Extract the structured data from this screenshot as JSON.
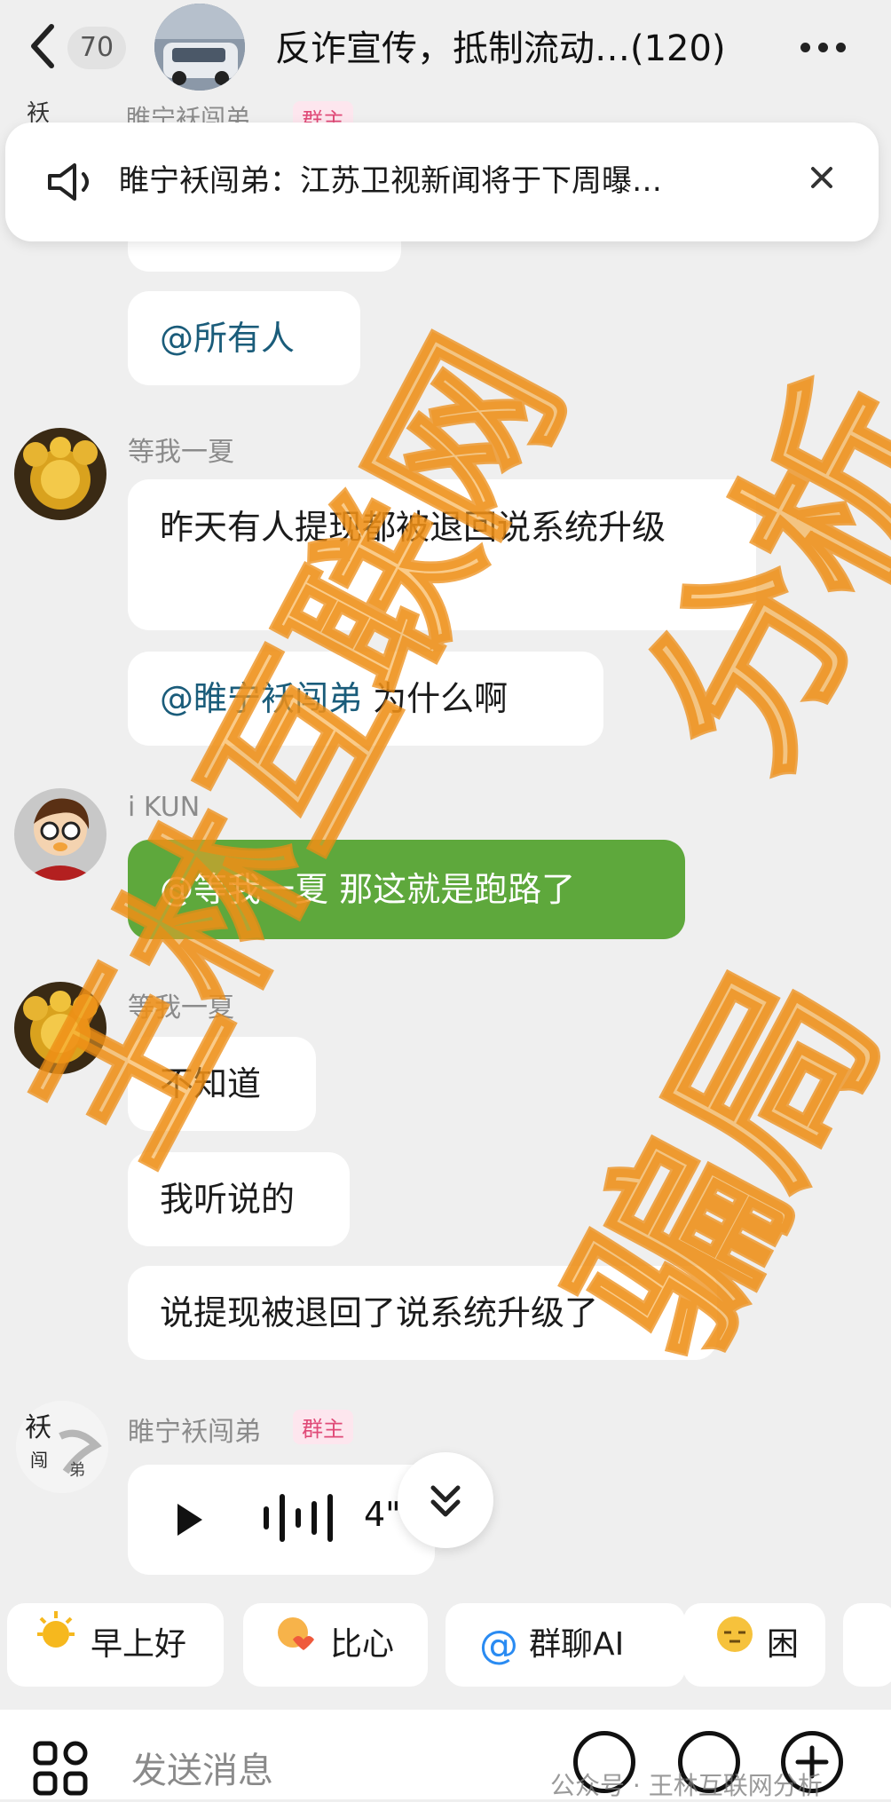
{
  "header": {
    "back_count": "70",
    "title": "反诈宣传，抵制流动…(120)"
  },
  "peek": {
    "sender": "睢宁袄闯弟",
    "role_tag": "群主"
  },
  "announcement": {
    "text": "睢宁袄闯弟：江苏卫视新闻将于下周曝…"
  },
  "messages": [
    {
      "text": "@所有人"
    },
    {
      "sender": "等我一夏",
      "bubbles": [
        {
          "text": "昨天有人提现都被退回说系统升级"
        },
        {
          "mention": "@睢宁袄闯弟",
          "text": " 为什么啊"
        }
      ]
    },
    {
      "sender": "i KUN",
      "bubbles": [
        {
          "mention": "@等我一夏",
          "text": " 那这就是跑路了"
        }
      ]
    },
    {
      "sender": "等我一夏",
      "bubbles": [
        {
          "text": "不知道"
        },
        {
          "text": "我听说的"
        },
        {
          "text": "说提现被退回了说系统升级了"
        }
      ]
    },
    {
      "sender": "睢宁袄闯弟",
      "role_tag": "群主",
      "voice_duration": "4\""
    }
  ],
  "quick_replies": [
    {
      "icon": "sun-emoji-icon",
      "label": "早上好"
    },
    {
      "icon": "heart-hand-emoji-icon",
      "label": "比心"
    },
    {
      "icon": "at-icon",
      "label": "群聊AI"
    },
    {
      "icon": "sleepy-emoji-icon",
      "label": "困"
    }
  ],
  "input": {
    "placeholder": "发送消息"
  },
  "watermark": {
    "line1": "王林互联网",
    "line2": "分析",
    "line3": "骗局",
    "footer": "公众号 · 王林互联网分析"
  },
  "colors": {
    "accent_green": "#5ea83c",
    "mention": "#1a5c7a",
    "watermark": "#f5a028",
    "owner_tag": "#e04b78"
  }
}
